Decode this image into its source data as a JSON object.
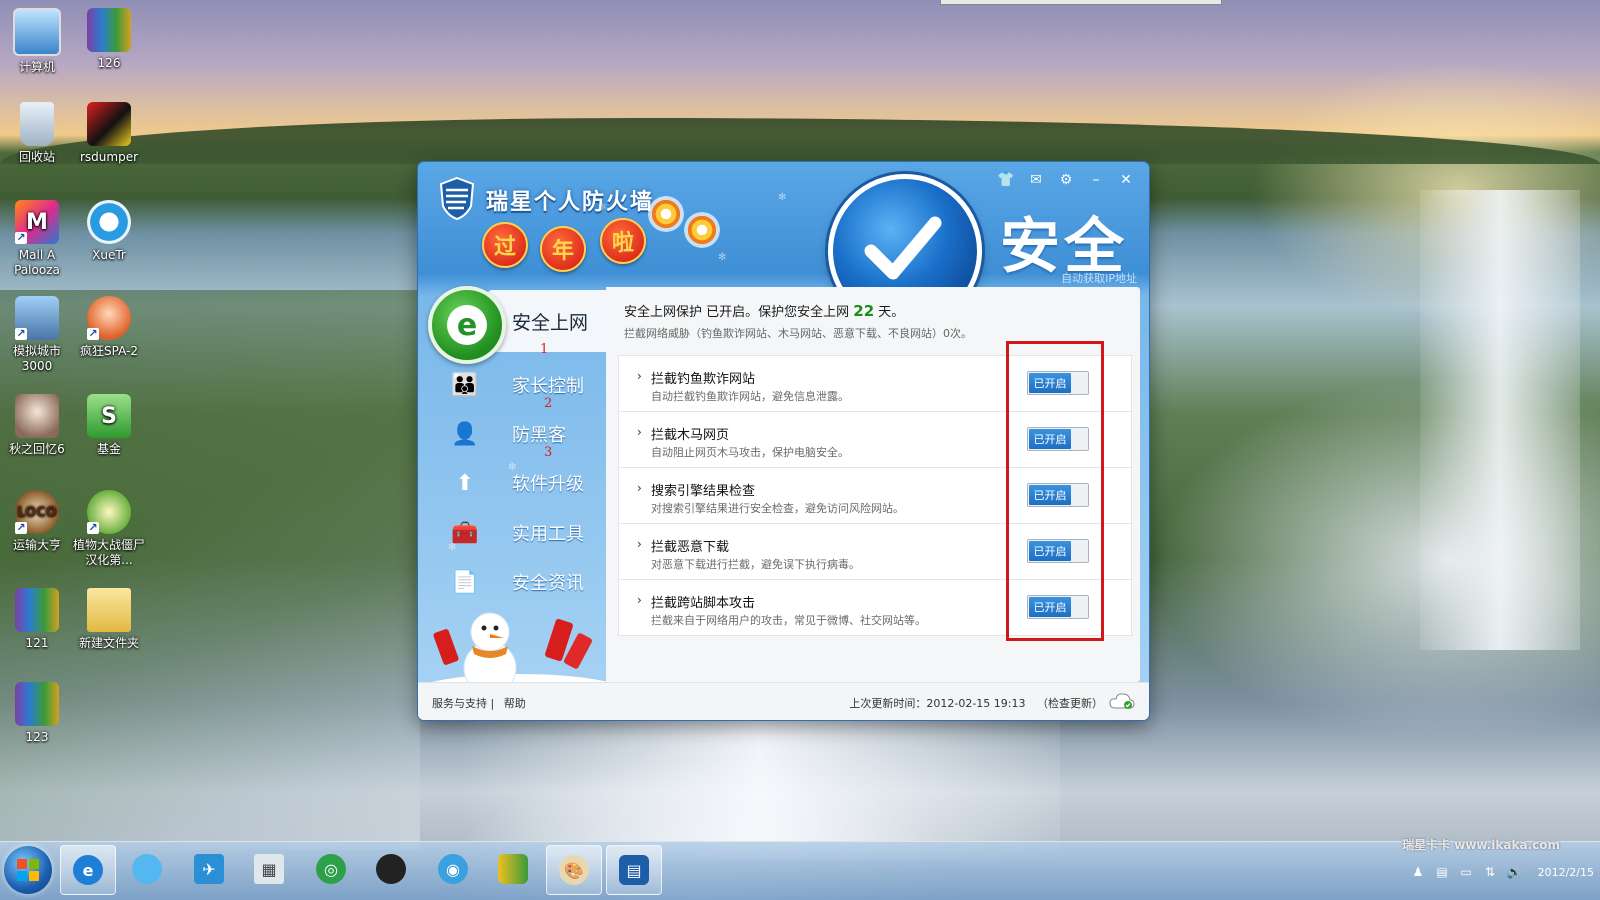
{
  "desktop": {
    "icons": [
      {
        "label": "计算机"
      },
      {
        "label": "126"
      },
      {
        "label": "回收站"
      },
      {
        "label": "rsdumper"
      },
      {
        "label": "Mall A Palooza"
      },
      {
        "label": "XueTr"
      },
      {
        "label": "模拟城市3000"
      },
      {
        "label": "疯狂SPA-2"
      },
      {
        "label": "秋之回忆6"
      },
      {
        "label": "基金"
      },
      {
        "label": "运输大亨"
      },
      {
        "label": "植物大战僵尸 汉化第..."
      },
      {
        "label": "121"
      },
      {
        "label": "新建文件夹"
      },
      {
        "label": "123"
      }
    ]
  },
  "firewall": {
    "title": "瑞星个人防火墙",
    "badges": [
      "过",
      "年",
      "啦"
    ],
    "status_word": "安全",
    "status_sub": "自动获取IP地址",
    "sidebar": {
      "items": [
        {
          "label": "安全上网",
          "annot": "1",
          "icon": "shield-e-icon"
        },
        {
          "label": "家长控制",
          "annot": "2",
          "icon": "parents-icon"
        },
        {
          "label": "防黑客",
          "annot": "3",
          "icon": "hacker-icon"
        },
        {
          "label": "软件升级",
          "icon": "upgrade-arrow-icon"
        },
        {
          "label": "实用工具",
          "icon": "toolbox-icon"
        },
        {
          "label": "安全资讯",
          "icon": "news-icon"
        }
      ]
    },
    "summary": {
      "prefix": "安全上网保护 已开启。保护您安全上网",
      "days": "22",
      "suffix": "天。",
      "sub": "拦截网络威胁（钓鱼欺诈网站、木马网站、恶意下载、不良网站）0次。"
    },
    "rules": [
      {
        "title": "拦截钓鱼欺诈网站",
        "desc": "自动拦截钓鱼欺诈网站，避免信息泄露。",
        "toggle": "已开启"
      },
      {
        "title": "拦截木马网页",
        "desc": "自动阻止网页木马攻击，保护电脑安全。",
        "toggle": "已开启"
      },
      {
        "title": "搜索引擎结果检查",
        "desc": "对搜索引擎结果进行安全检查，避免访问风险网站。",
        "toggle": "已开启"
      },
      {
        "title": "拦截恶意下载",
        "desc": "对恶意下载进行拦截，避免误下执行病毒。",
        "toggle": "已开启"
      },
      {
        "title": "拦截跨站脚本攻击",
        "desc": "拦截来自于网络用户的攻击，常见于微博、社交网站等。",
        "toggle": "已开启"
      }
    ],
    "footer": {
      "support": "服务与支持",
      "sep": "|",
      "help": "帮助",
      "update_text": "上次更新时间：2012-02-15 19:13",
      "check_update": "（检查更新）"
    }
  },
  "taskbar": {
    "clock_time": "",
    "clock_date": "2012/2/15",
    "watermark": "瑞星卡卡 www.ikaka.com"
  }
}
